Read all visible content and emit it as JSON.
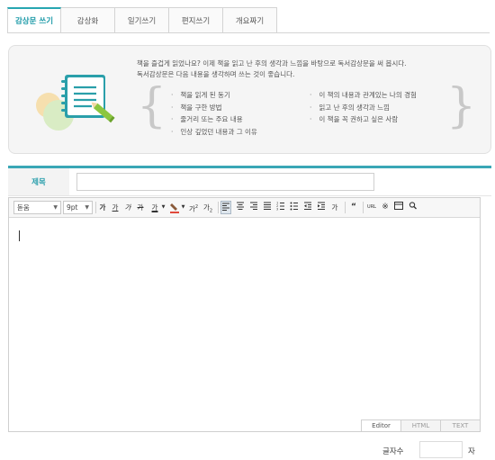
{
  "tabs": [
    "감상문 쓰기",
    "감상화",
    "일기쓰기",
    "편지쓰기",
    "개요짜기"
  ],
  "guide": {
    "intro_line1": "책을 즐겁게 읽었나요? 이제 책을 읽고 난 후의 생각과 느낌을 바탕으로 독서감상문을 써 봅시다.",
    "intro_line2": "독서감상문은 다음 내용을 생각하며 쓰는 것이 좋습니다.",
    "tips_col1": [
      "책을 읽게 된 동기",
      "책을 구한 방법",
      "줄거리 또는 주요 내용",
      "인상 깊었던 내용과 그 이유"
    ],
    "tips_col2": [
      "이 책의 내용과 관계있는 나의 경험",
      "읽고 난 후의 생각과 느낌",
      "이 책을 꼭 권하고 싶은 사람"
    ],
    "icon": "notebook-pencil-icon"
  },
  "title_field": {
    "label": "제목",
    "value": ""
  },
  "toolbar": {
    "font": "돋움",
    "size": "9pt",
    "buttons": [
      "가",
      "가",
      "가",
      "가",
      "가",
      "가",
      "가",
      "가"
    ],
    "url_label": "URL"
  },
  "editor": {
    "modes": [
      "Editor",
      "HTML",
      "TEXT"
    ],
    "active_mode": "Editor"
  },
  "count": {
    "label": "글자수",
    "value": "",
    "unit": "자"
  },
  "colors": {
    "accent": "#27a6b1",
    "divider": "#3aa7b6",
    "icon_teal": "#2a9faa",
    "icon_green": "#8cc63f"
  }
}
